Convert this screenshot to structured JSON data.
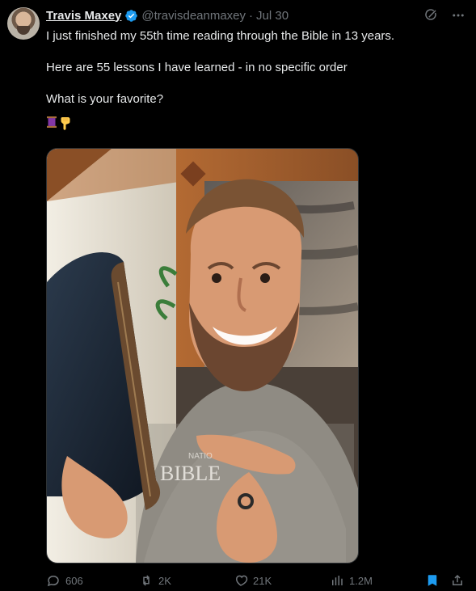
{
  "author": {
    "name": "Travis Maxey",
    "handle": "@travisdeanmaxey",
    "date": "Jul 30"
  },
  "tweet": {
    "line1": "I just finished my 55th time reading through the Bible in 13 years.",
    "line2": "Here are 55 lessons I have learned - in no specific order",
    "line3": "What is your favorite?"
  },
  "icons": {
    "thread": "thread-spool-emoji",
    "point": "backhand-index-pointing-down-emoji",
    "verified": "verified-badge",
    "grok": "grok-icon",
    "more": "more-icon",
    "reply": "reply-icon",
    "repost": "repost-icon",
    "like": "like-icon",
    "views": "views-icon",
    "bookmark": "bookmark-icon",
    "share": "share-icon"
  },
  "metrics": {
    "replies": "606",
    "reposts": "2K",
    "likes": "21K",
    "views": "1.2M"
  },
  "colors": {
    "background": "#000000",
    "text": "#e7e9ea",
    "muted": "#71767b",
    "verified": "#1d9bf0",
    "bookmark_active": "#1d9bf0"
  }
}
